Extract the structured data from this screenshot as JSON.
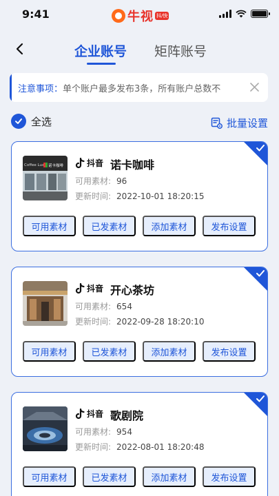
{
  "status_bar": {
    "time": "9:41"
  },
  "app": {
    "logo_text": "牛视",
    "logo_tag": "抖/快"
  },
  "tabs": [
    {
      "label": "企业账号",
      "active": true
    },
    {
      "label": "矩阵账号",
      "active": false
    }
  ],
  "notice": {
    "label": "注意事项：",
    "text": "单个账户最多发布3条，所有账户总数不"
  },
  "toolbar": {
    "select_all_label": "全选",
    "batch_settings_label": "批量设置"
  },
  "accounts": [
    {
      "platform": "抖音",
      "name": "诺卡咖啡",
      "material_label": "可用素材:",
      "material_count": "96",
      "updated_label": "更新时间:",
      "updated_time": "2022-10-01 18:20:15",
      "thumb_sign": "Coffee Lux",
      "thumb_sign_cn": "诺卡咖啡",
      "selected": true
    },
    {
      "platform": "抖音",
      "name": "开心茶坊",
      "material_label": "可用素材:",
      "material_count": "654",
      "updated_label": "更新时间:",
      "updated_time": "2022-09-28 18:20:10",
      "selected": true
    },
    {
      "platform": "抖音",
      "name": "歌剧院",
      "material_label": "可用素材:",
      "material_count": "954",
      "updated_label": "更新时间:",
      "updated_time": "2022-08-01 18:20:48",
      "selected": true
    }
  ],
  "card_actions": [
    "可用素材",
    "已发素材",
    "添加素材",
    "发布设置"
  ],
  "colors": {
    "accent": "#1f56d8",
    "background": "#eef1f7",
    "button_bg": "#e6eefc",
    "brand_red": "#e8332b"
  }
}
